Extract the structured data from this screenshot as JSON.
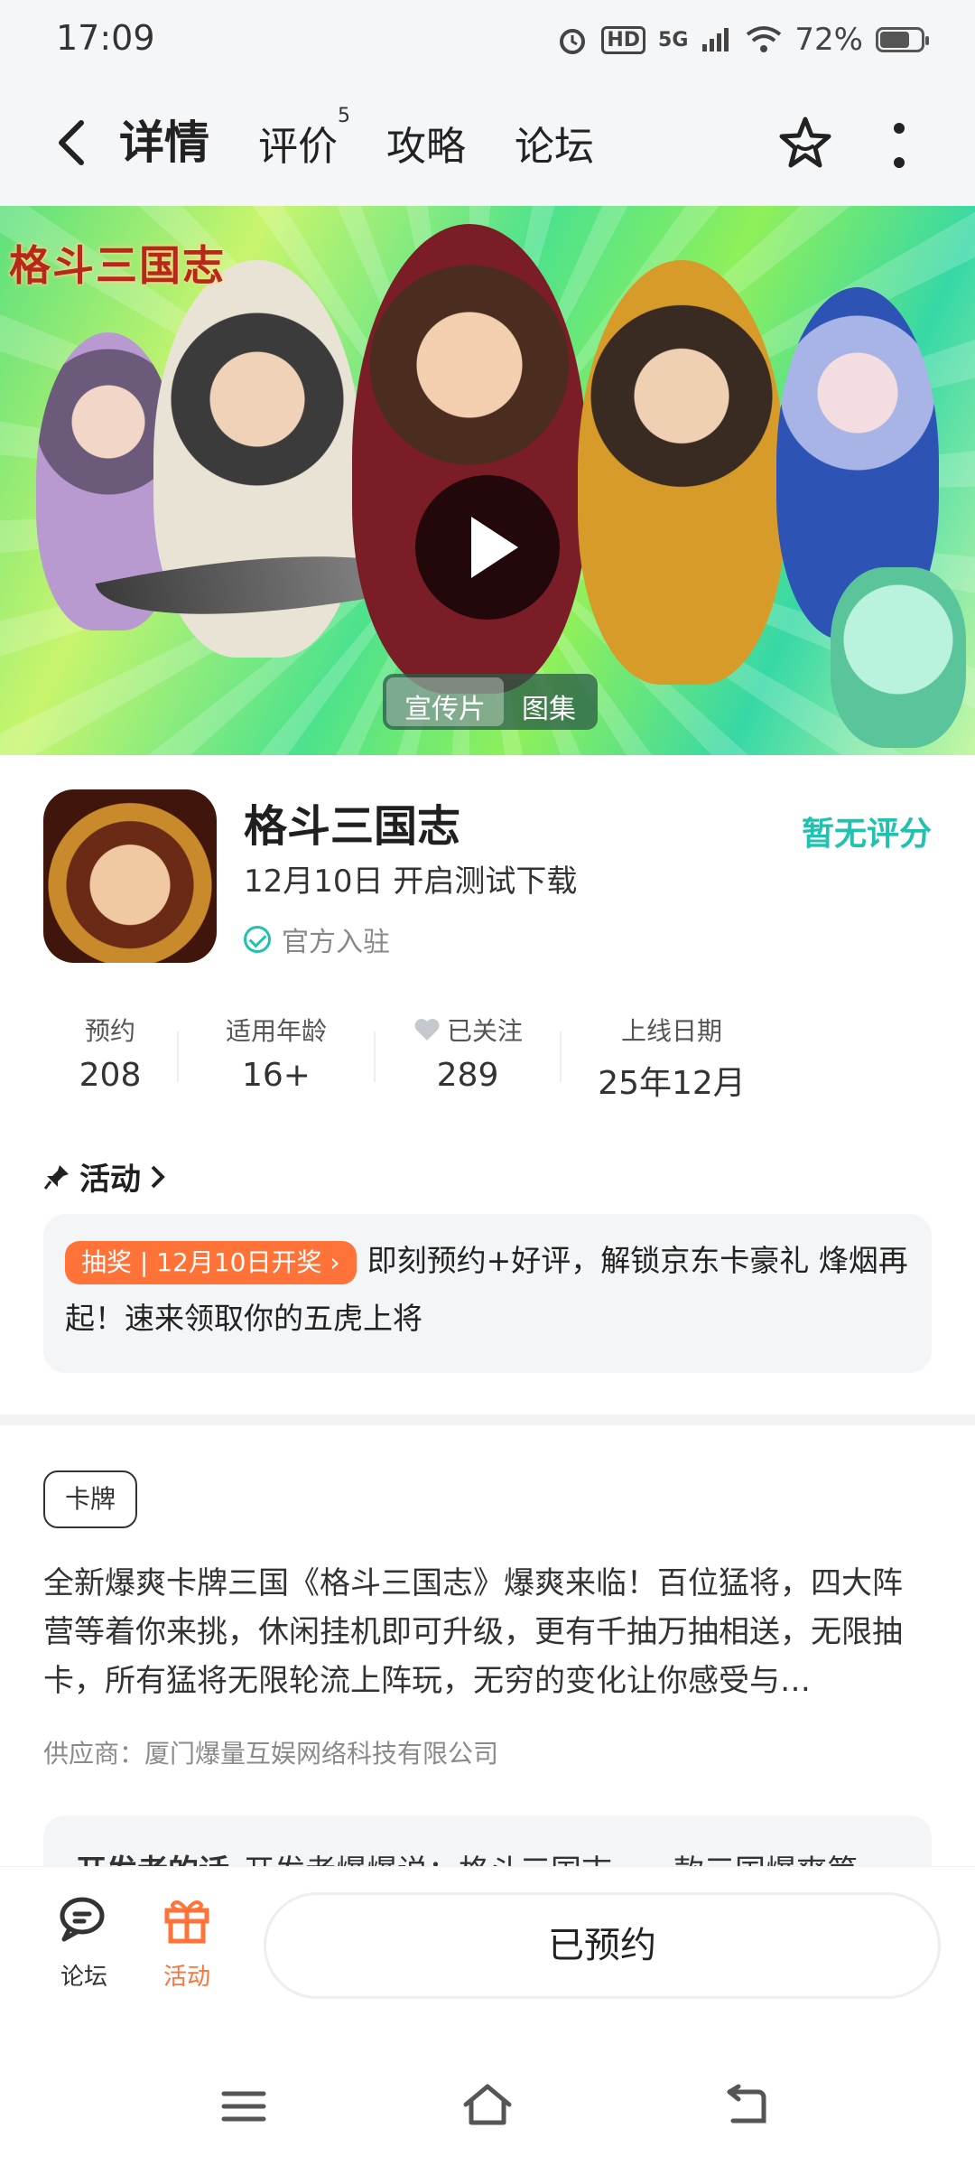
{
  "status": {
    "time": "17:09",
    "network": "5G",
    "hd": "HD",
    "battery_text": "72%",
    "battery_level": 0.72
  },
  "nav": {
    "tabs": [
      {
        "label": "详情",
        "active": true
      },
      {
        "label": "评价",
        "badge": "5"
      },
      {
        "label": "攻略"
      },
      {
        "label": "论坛"
      }
    ]
  },
  "hero": {
    "logo_text": "格斗三国志",
    "segments": [
      {
        "label": "宣传片",
        "active": true
      },
      {
        "label": "图集"
      }
    ]
  },
  "app": {
    "title": "格斗三国志",
    "subtitle": "12月10日 开启测试下载",
    "official": "官方入驻",
    "rating": "暂无评分"
  },
  "stats": [
    {
      "label": "预约",
      "value": "208"
    },
    {
      "label": "适用年龄",
      "value": "16+"
    },
    {
      "label": "已关注",
      "value": "289"
    },
    {
      "label": "上线日期",
      "value": "25年12月"
    }
  ],
  "activity": {
    "header": "活动",
    "tag": "抽奖 | 12月10日开奖",
    "text": "即刻预约+好评，解锁京东卡豪礼 烽烟再起！速来领取你的五虎上将"
  },
  "detail": {
    "genre": "卡牌",
    "description": "全新爆爽卡牌三国《格斗三国志》爆爽来临！百位猛将，四大阵营等着你来挑，休闲挂机即可升级，更有千抽万抽相送，无限抽卡，所有猛将无限轮流上阵玩，无穷的变化让你感受与…",
    "supplier": "供应商：厦门爆量互娱网络科技有限公司",
    "dev_title": "开发者的话",
    "dev_text": "开发者爆爆说：格斗三国志，一款三国爆爽第"
  },
  "bottom": {
    "forum": "论坛",
    "activity": "活动",
    "reserve_button": "已预约"
  },
  "colors": {
    "accent": "#21c1b0",
    "orange": "#ff7338"
  }
}
